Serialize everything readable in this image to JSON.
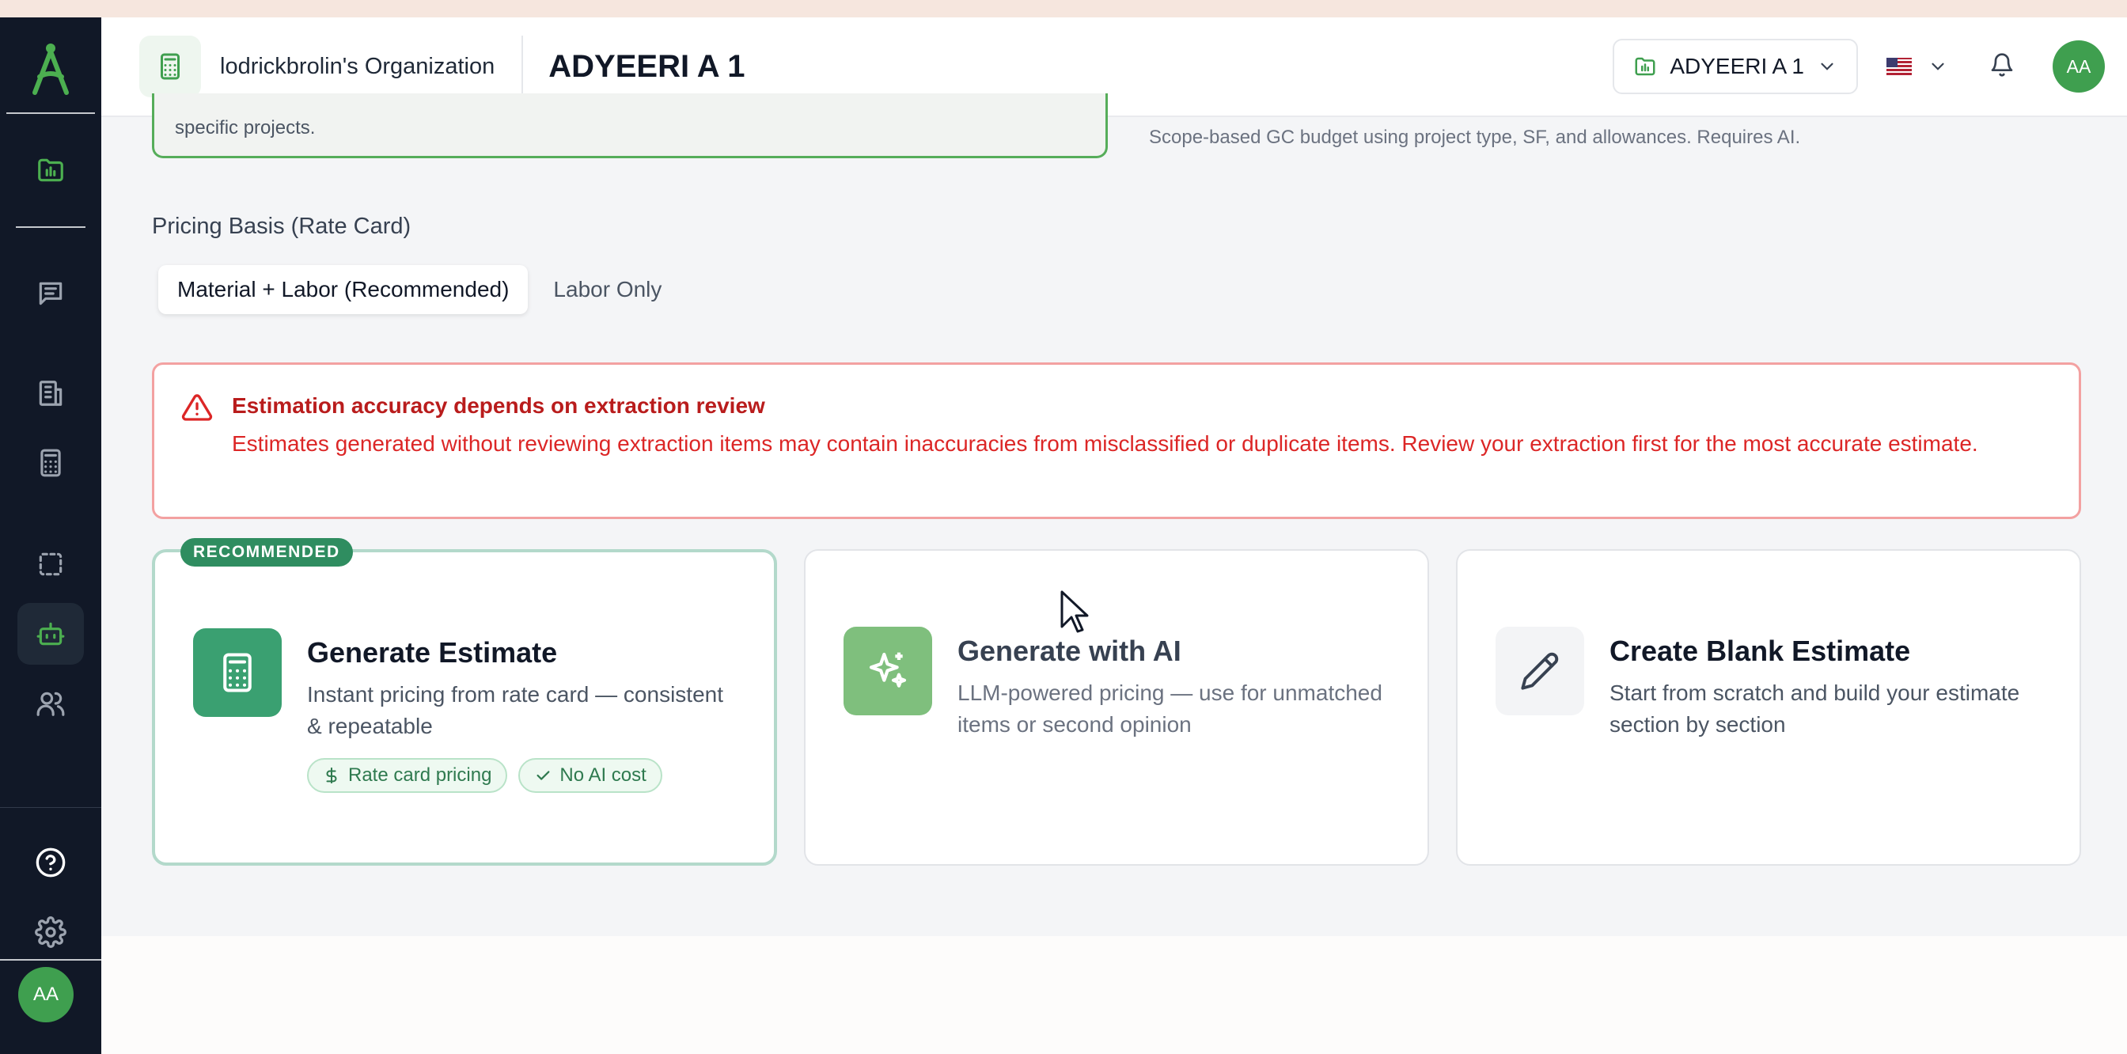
{
  "header": {
    "org_name": "lodrickbrolin's Organization",
    "project_title": "ADYEERI A 1",
    "project_select": "ADYEERI A 1",
    "avatar_initials": "AA"
  },
  "sidebar": {
    "avatar_initials": "AA",
    "items": [
      "dashboard",
      "messages",
      "buildings",
      "calculator",
      "selection",
      "ai-bot",
      "users",
      "help",
      "settings"
    ]
  },
  "partial": {
    "prev_card_text": "specific projects.",
    "prev_note": "Scope-based GC budget using project type, SF, and allowances. Requires AI."
  },
  "pricing": {
    "label": "Pricing Basis (Rate Card)",
    "options": [
      "Material + Labor (Recommended)",
      "Labor Only"
    ],
    "selected": "Material + Labor (Recommended)"
  },
  "alert": {
    "title": "Estimation accuracy depends on extraction review",
    "body": "Estimates generated without reviewing extraction items may contain inaccuracies from misclassified or duplicate items. Review your extraction first for the most accurate estimate."
  },
  "cards": [
    {
      "badge": "RECOMMENDED",
      "title": "Generate Estimate",
      "desc": "Instant pricing from rate card — consistent & repeatable",
      "pills": [
        "Rate card pricing",
        "No AI cost"
      ]
    },
    {
      "title": "Generate with AI",
      "desc": "LLM-powered pricing — use for unmatched items or second opinion"
    },
    {
      "title": "Create Blank Estimate",
      "desc": "Start from scratch and build your estimate section by section"
    }
  ],
  "colors": {
    "accent_green": "#3f9f4f",
    "recommended_green": "#2f8d60",
    "sidebar_bg": "#111827",
    "alert_red": "#dc2626"
  }
}
